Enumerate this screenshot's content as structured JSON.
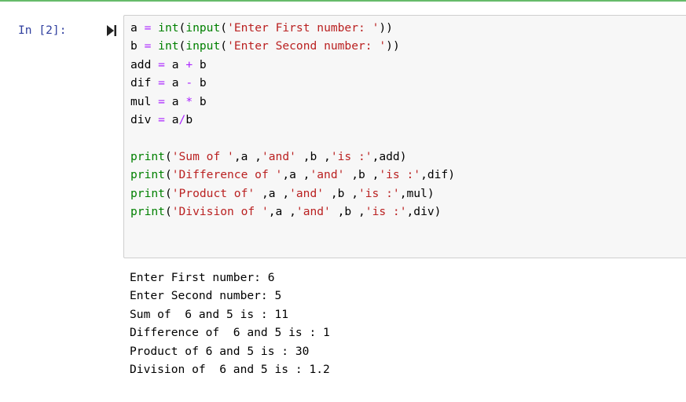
{
  "cell": {
    "prompt": "In [2]:",
    "run_icon": "run-cell-icon",
    "code": [
      [
        "a ",
        "=",
        " ",
        "int",
        "(",
        "input",
        "(",
        "'Enter First number: '",
        "))"
      ],
      [
        "b ",
        "=",
        " ",
        "int",
        "(",
        "input",
        "(",
        "'Enter Second number: '",
        "))"
      ],
      [
        "add ",
        "=",
        " a ",
        "+",
        " b"
      ],
      [
        "dif ",
        "=",
        " a ",
        "-",
        " b"
      ],
      [
        "mul ",
        "=",
        " a ",
        "*",
        " b"
      ],
      [
        "div ",
        "=",
        " a",
        "/",
        "b"
      ],
      [
        ""
      ],
      [
        "print",
        "(",
        "'Sum of '",
        ",a ,",
        "'and'",
        " ,b ,",
        "'is :'",
        ",add)"
      ],
      [
        "print",
        "(",
        "'Difference of '",
        ",a ,",
        "'and'",
        " ,b ,",
        "'is :'",
        ",dif)"
      ],
      [
        "print",
        "(",
        "'Product of'",
        " ,a ,",
        "'and'",
        " ,b ,",
        "'is :'",
        ",mul)"
      ],
      [
        "print",
        "(",
        "'Division of '",
        ",a ,",
        "'and'",
        " ,b ,",
        "'is :'",
        ",div)"
      ]
    ],
    "code_styles": [
      [
        "",
        "o",
        "",
        "k",
        "",
        "k",
        "",
        "s",
        ""
      ],
      [
        "",
        "o",
        "",
        "k",
        "",
        "k",
        "",
        "s",
        ""
      ],
      [
        "",
        "o",
        "",
        "o",
        ""
      ],
      [
        "",
        "o",
        "",
        "o",
        ""
      ],
      [
        "",
        "o",
        "",
        "o",
        ""
      ],
      [
        "",
        "o",
        "",
        "o",
        ""
      ],
      [
        ""
      ],
      [
        "k",
        "",
        "s",
        "",
        "s",
        "",
        "s",
        ""
      ],
      [
        "k",
        "",
        "s",
        "",
        "s",
        "",
        "s",
        ""
      ],
      [
        "k",
        "",
        "s",
        "",
        "s",
        "",
        "s",
        ""
      ],
      [
        "k",
        "",
        "s",
        "",
        "s",
        "",
        "s",
        ""
      ]
    ],
    "output": [
      "Enter First number: 6",
      "Enter Second number: 5",
      "Sum of  6 and 5 is : 11",
      "Difference of  6 and 5 is : 1",
      "Product of 6 and 5 is : 30",
      "Division of  6 and 5 is : 1.2"
    ]
  },
  "colors": {
    "selected_bar": "#66bb6a",
    "prompt": "#303f9f",
    "keyword": "#008000",
    "string": "#ba2121",
    "operator": "#aa22ff",
    "code_background": "#f7f7f7"
  }
}
